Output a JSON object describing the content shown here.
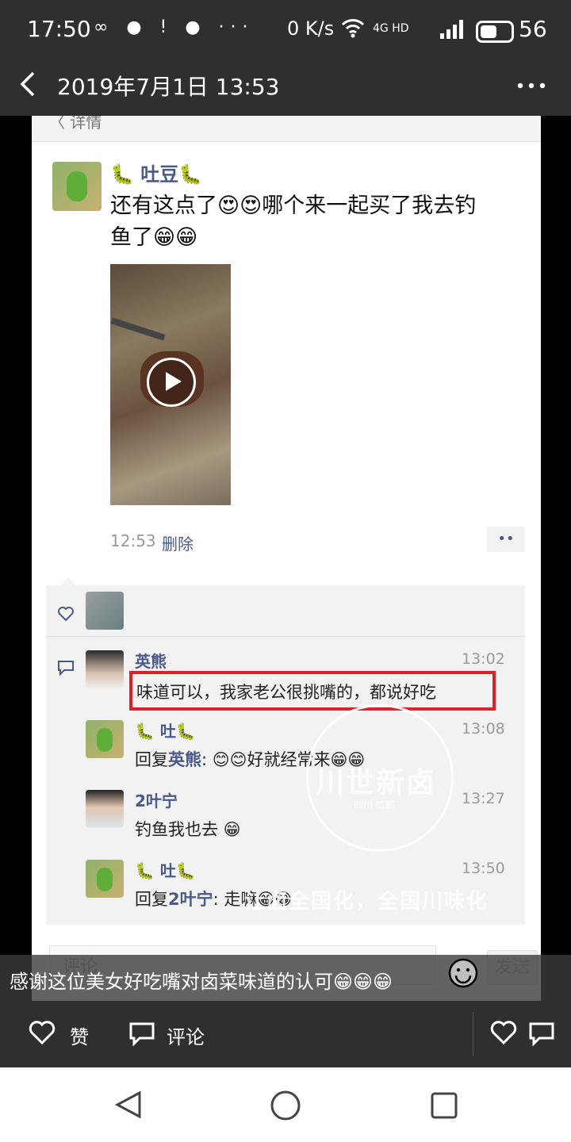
{
  "status_bar": {
    "time": "17:50",
    "indicators": "∞ ● ! ● ···",
    "network_speed": "0 K/s",
    "network_labels": "4G HD",
    "battery_level": 56,
    "battery_text": "56"
  },
  "title_bar": {
    "back_icon": "chevron-left-icon",
    "title": "2019年7月1日 13:53",
    "more_icon": "more-dots-icon"
  },
  "screenshot": {
    "header": "〈 详情",
    "post": {
      "author": "🐛 吐豆🐛",
      "text_line1": "还有这点了😍😍哪个来一起买了我去钓",
      "text_line2": "鱼了😁😁",
      "time": "12:53",
      "delete_label": "删除",
      "more_label": "••"
    },
    "comments": [
      {
        "name": "英熊",
        "time": "13:02",
        "text": "味道可以，我家老公很挑嘴的，都说好吃"
      },
      {
        "name": "🐛 吐🐛",
        "time": "13:08",
        "prefix": "回复",
        "reply_to": "英熊",
        "text": ": 😊😊好就经常来😁😁"
      },
      {
        "name": "2叶宁",
        "time": "13:27",
        "text": "钓鱼我也去 😁"
      },
      {
        "name": "🐛 吐🐛",
        "time": "13:50",
        "prefix": "回复",
        "reply_to": "2叶宁",
        "text": ": 走嘛😁😁"
      }
    ],
    "watermark": {
      "brand": "川世新卤",
      "slogan": "让卤全国化，全国川味化",
      "sub": "四川·成都"
    },
    "input_placeholder": "评论",
    "send_label": "发送"
  },
  "caption": "感谢这位美女好吃嘴对卤菜味道的认可😁😁😁",
  "actions": {
    "like_label": "赞",
    "comment_label": "评论"
  },
  "colors": {
    "bar": "#2f2f2f",
    "link_blue": "#4a5a88",
    "highlight_red": "#d9232a",
    "comment_bg": "#f2f2f2"
  }
}
